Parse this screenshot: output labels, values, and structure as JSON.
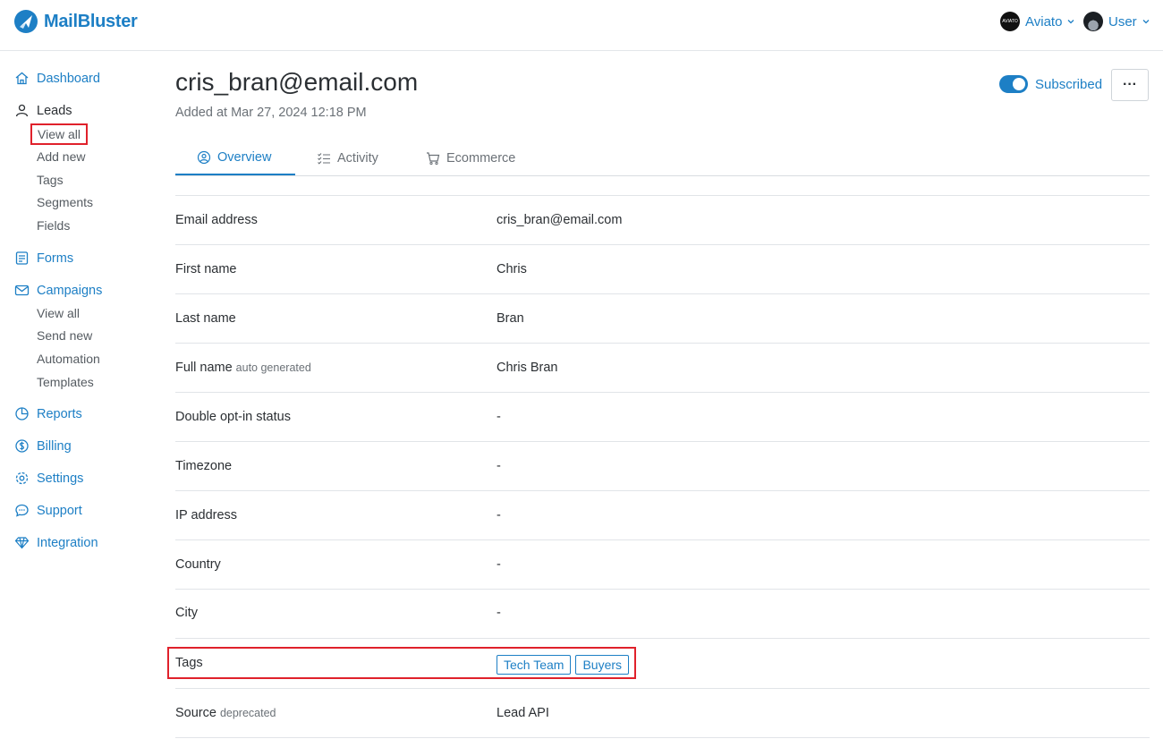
{
  "brand": {
    "name": "MailBluster",
    "color": "#1d7fc5"
  },
  "header": {
    "workspace": {
      "label": "Aviato",
      "avatar_text": "AVIATO"
    },
    "user": {
      "label": "User"
    }
  },
  "sidebar": {
    "dashboard": "Dashboard",
    "leads": {
      "label": "Leads",
      "items": [
        "View all",
        "Add new",
        "Tags",
        "Segments",
        "Fields"
      ]
    },
    "forms": "Forms",
    "campaigns": {
      "label": "Campaigns",
      "items": [
        "View all",
        "Send new",
        "Automation",
        "Templates"
      ]
    },
    "reports": "Reports",
    "billing": "Billing",
    "settings": "Settings",
    "support": "Support",
    "integration": "Integration"
  },
  "lead": {
    "email": "cris_bran@email.com",
    "added": "Added at Mar 27, 2024 12:18 PM",
    "subscribed_label": "Subscribed",
    "subscribed": true,
    "more_label": "···"
  },
  "tabs": [
    {
      "label": "Overview",
      "active": true
    },
    {
      "label": "Activity",
      "active": false
    },
    {
      "label": "Ecommerce",
      "active": false
    }
  ],
  "fields": [
    {
      "label": "Email address",
      "note": "",
      "value": "cris_bran@email.com"
    },
    {
      "label": "First name",
      "note": "",
      "value": "Chris"
    },
    {
      "label": "Last name",
      "note": "",
      "value": "Bran"
    },
    {
      "label": "Full name",
      "note": "auto generated",
      "value": "Chris Bran"
    },
    {
      "label": "Double opt-in status",
      "note": "",
      "value": "-"
    },
    {
      "label": "Timezone",
      "note": "",
      "value": "-"
    },
    {
      "label": "IP address",
      "note": "",
      "value": "-"
    },
    {
      "label": "Country",
      "note": "",
      "value": "-"
    },
    {
      "label": "City",
      "note": "",
      "value": "-"
    },
    {
      "label": "Tags",
      "note": "",
      "tags": [
        "Tech Team",
        "Buyers"
      ]
    },
    {
      "label": "Source",
      "note": "deprecated",
      "value": "Lead API"
    }
  ],
  "highlight_color": "#e0212b"
}
